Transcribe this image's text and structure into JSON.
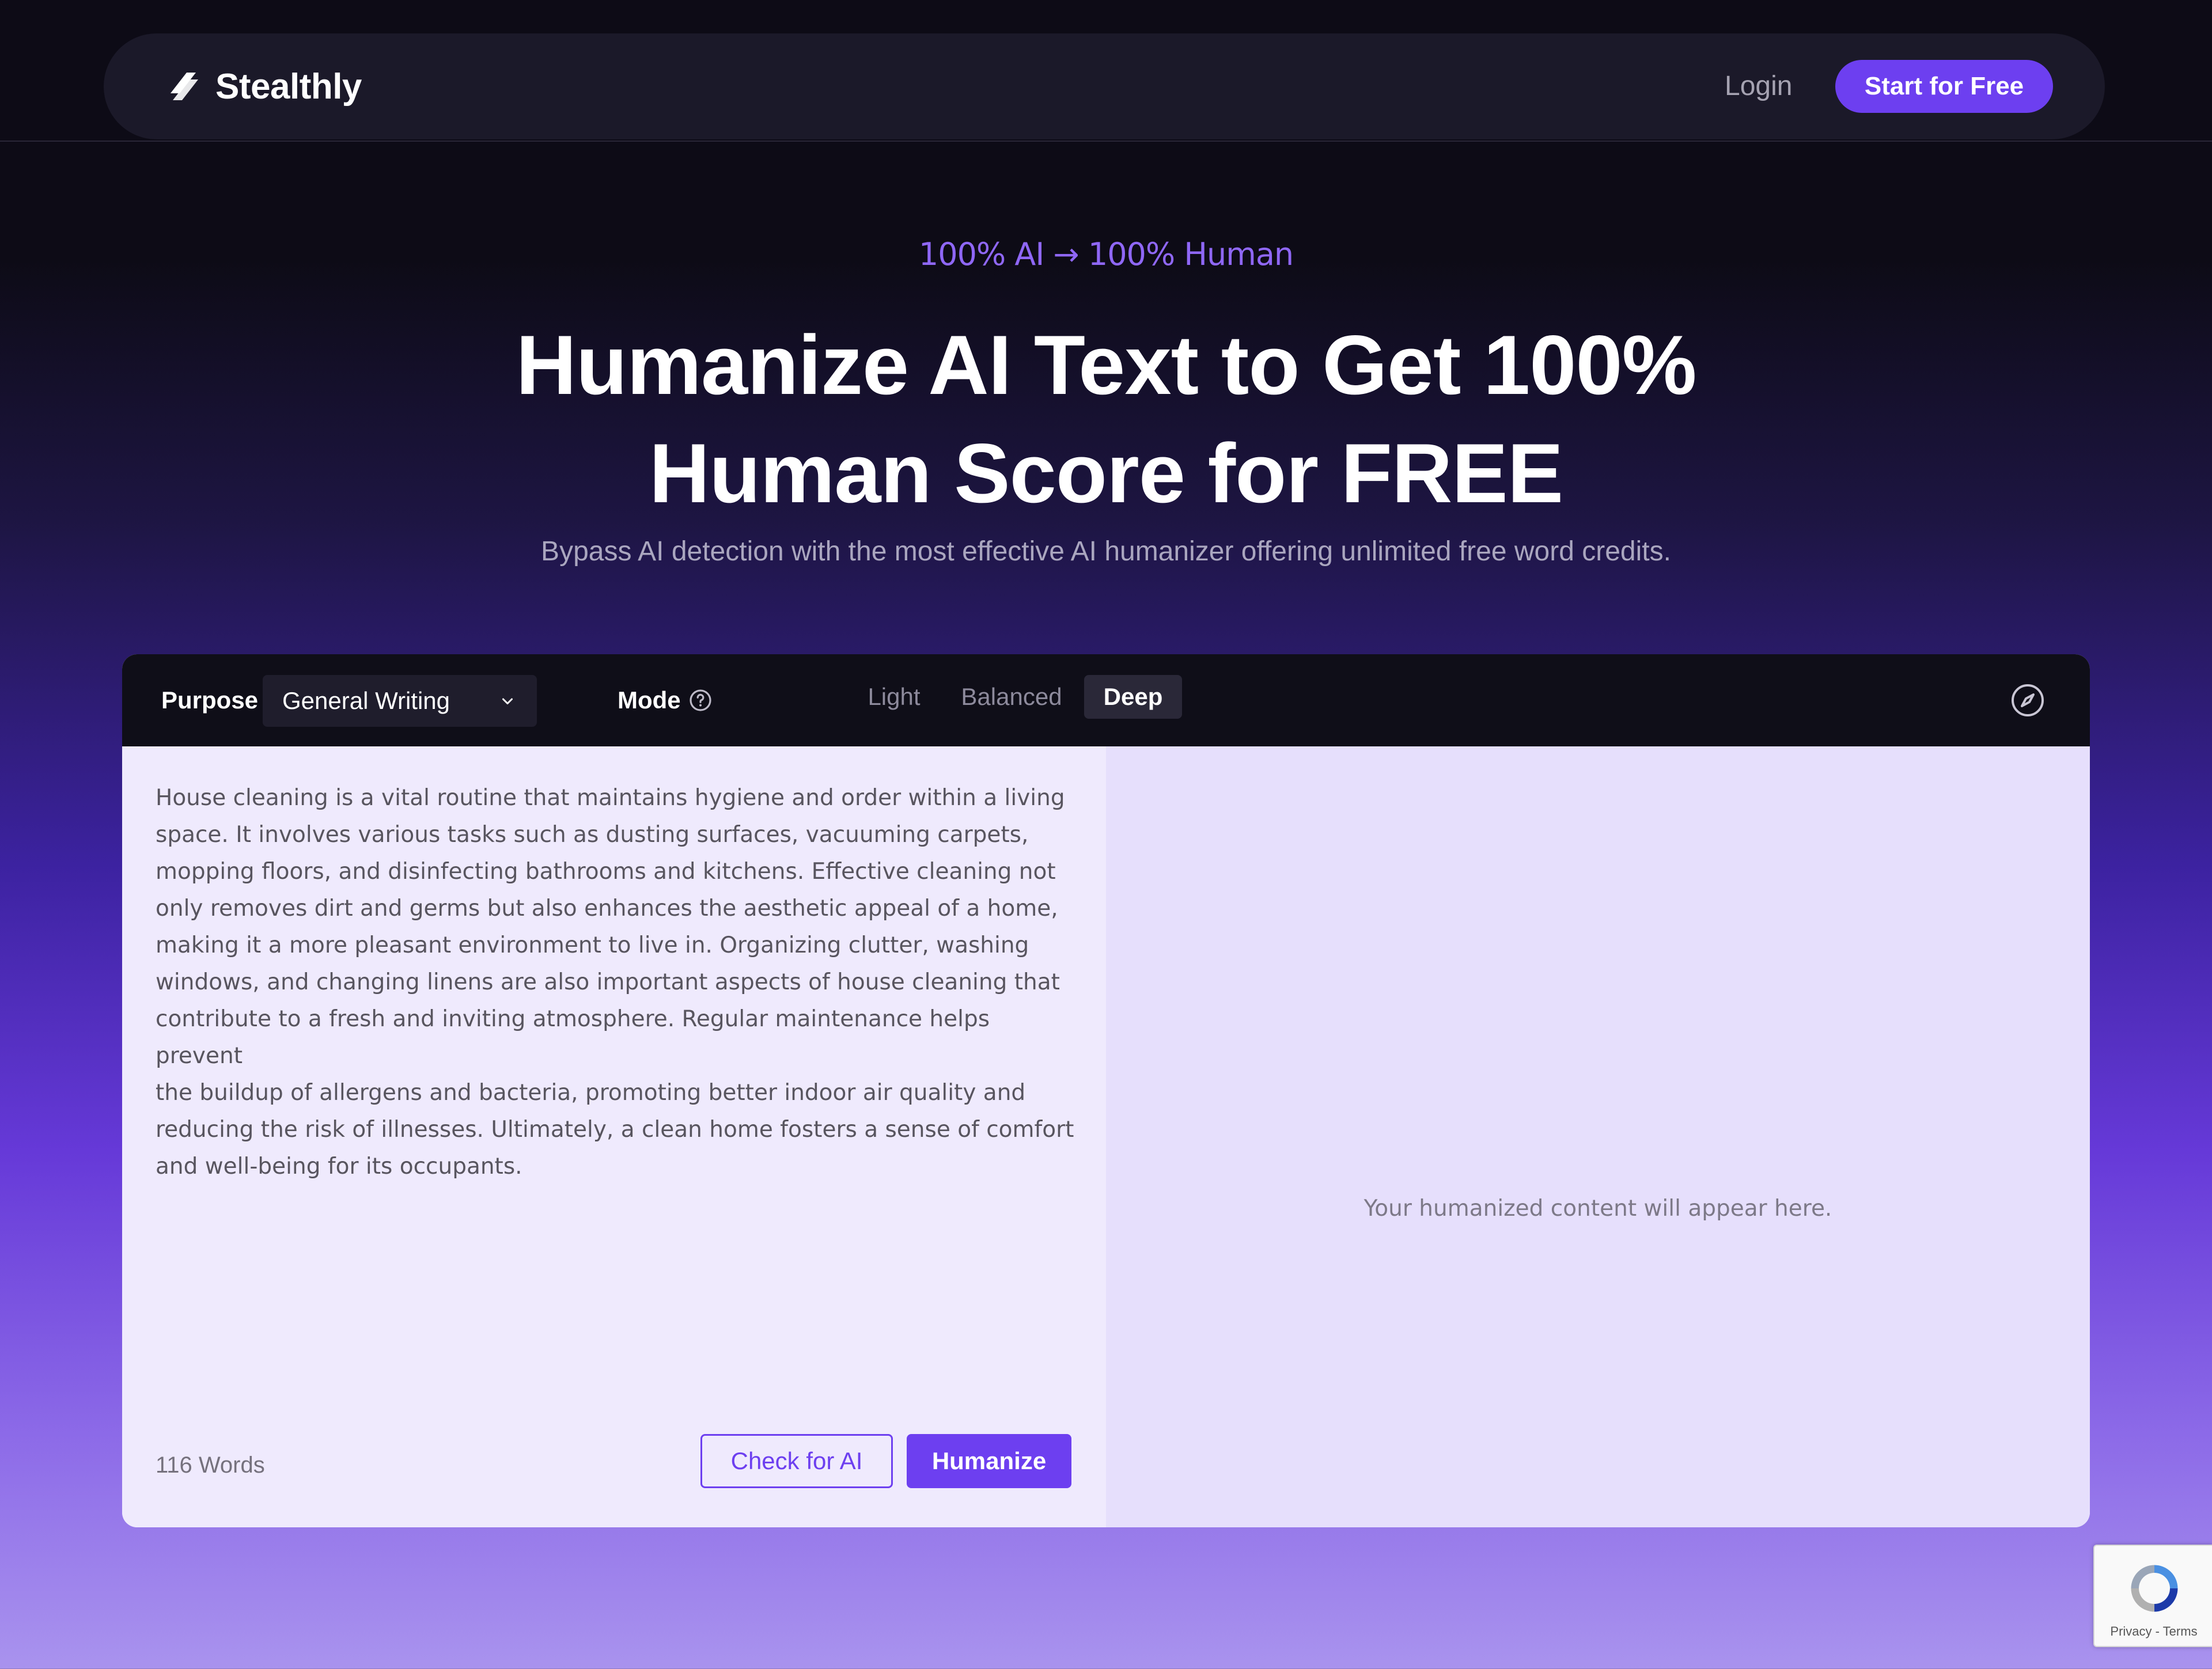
{
  "nav": {
    "brand": "Stealthly",
    "login_label": "Login",
    "cta_label": "Start for Free"
  },
  "hero": {
    "eyebrow": "100% AI → 100% Human",
    "title_line1": "Humanize AI Text to Get 100%",
    "title_line2": "Human Score for FREE",
    "subtitle": "Bypass AI detection with the most effective AI humanizer offering unlimited free word credits."
  },
  "toolbar": {
    "purpose_label": "Purpose",
    "purpose_value": "General Writing",
    "mode_label": "Mode",
    "modes": [
      "Light",
      "Balanced",
      "Deep"
    ],
    "active_mode": "Deep"
  },
  "editor": {
    "input_lines": [
      "House cleaning is a vital routine that maintains hygiene and order within a living",
      "space. It involves various tasks such as dusting surfaces, vacuuming carpets,",
      "mopping floors, and disinfecting bathrooms and kitchens. Effective cleaning not",
      "only removes dirt and germs but also enhances the aesthetic appeal of a home,",
      "making it a more pleasant environment to live in. Organizing clutter, washing",
      "windows, and changing linens are also important aspects of house cleaning that",
      "contribute to a fresh and inviting atmosphere. Regular maintenance helps prevent",
      "the buildup of allergens and bacteria, promoting better indoor air quality and",
      "reducing the risk of illnesses. Ultimately, a clean home fosters a sense of comfort",
      "and well-being for its occupants."
    ],
    "word_count": "116 Words",
    "check_label": "Check for AI",
    "humanize_label": "Humanize",
    "output_placeholder": "Your humanized content will appear here."
  },
  "recaptcha": {
    "links": "Privacy - Terms"
  },
  "colors": {
    "accent": "#6d3ff0",
    "eyebrow": "#8f67f6",
    "background_dark": "#0d0b16"
  },
  "icons": [
    "logo-icon",
    "help-circle-icon",
    "chevron-down-icon",
    "compass-icon",
    "recaptcha-icon"
  ]
}
